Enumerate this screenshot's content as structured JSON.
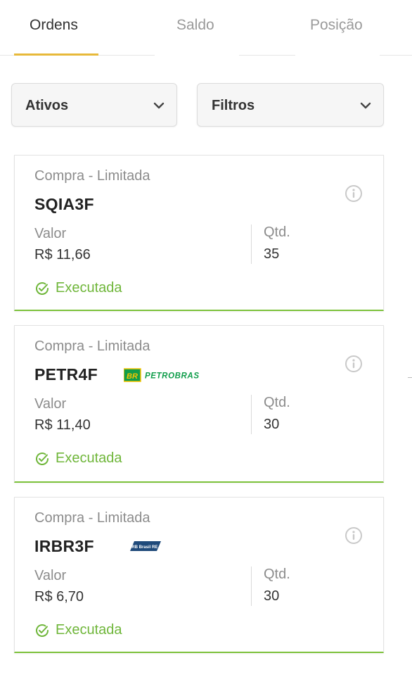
{
  "tabs": [
    {
      "label": "Ordens",
      "active": true
    },
    {
      "label": "Saldo",
      "active": false
    },
    {
      "label": "Posição",
      "active": false
    }
  ],
  "filters": {
    "assets_label": "Ativos",
    "filters_label": "Filtros"
  },
  "orders": [
    {
      "type": "Compra - Limitada",
      "ticker": "SQIA3F",
      "value_label": "Valor",
      "value": "R$ 11,66",
      "qty_label": "Qtd.",
      "qty": "35",
      "status": "Executada",
      "logo": ""
    },
    {
      "type": "Compra - Limitada",
      "ticker": "PETR4F",
      "value_label": "Valor",
      "value": "R$ 11,40",
      "qty_label": "Qtd.",
      "qty": "30",
      "status": "Executada",
      "logo": "PETROBRAS"
    },
    {
      "type": "Compra - Limitada",
      "ticker": "IRBR3F",
      "value_label": "Valor",
      "value": "R$ 6,70",
      "qty_label": "Qtd.",
      "qty": "30",
      "status": "Executada",
      "logo": "IRB Brasil RE"
    }
  ],
  "colors": {
    "accent": "#e7b93a",
    "success": "#6fb63a",
    "card_border_success": "#7cc13a",
    "petrobras_green": "#0f9d4a"
  }
}
